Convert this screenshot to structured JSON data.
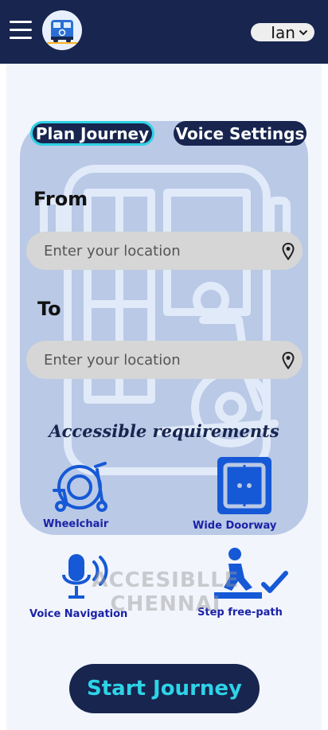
{
  "header": {
    "menu_icon": "hamburger-menu-icon",
    "logo_icon": "accessible-bus-logo",
    "user_name": "Ian",
    "user_dropdown_icon": "chevron-down-icon"
  },
  "tabs": {
    "plan_journey": "Plan Journey",
    "voice_settings": "Voice Settings",
    "active": "plan_journey"
  },
  "form": {
    "from_label": "From",
    "from_placeholder": "Enter your location",
    "to_label": "To",
    "to_placeholder": "Enter your location",
    "pin_icon": "location-pin-icon"
  },
  "requirements": {
    "title": "Accessible requirements",
    "items": [
      {
        "label": "Wheelchair",
        "icon": "wheelchair-icon"
      },
      {
        "label": "Wide Doorway",
        "icon": "doorway-icon"
      },
      {
        "label": "Voice Navigation",
        "icon": "microphone-icon"
      },
      {
        "label": "Step free-path",
        "icon": "step-free-icon"
      }
    ]
  },
  "watermark": {
    "line1": "ACCESIBLLE",
    "line2": "CHENNAI"
  },
  "start_button": "Start Journey",
  "colors": {
    "header_bg": "#17254f",
    "accent_cyan": "#2ed3e6",
    "icon_blue": "#1659d6",
    "card_bg": "#b9c9e6",
    "label_blue": "#1a22a6"
  }
}
